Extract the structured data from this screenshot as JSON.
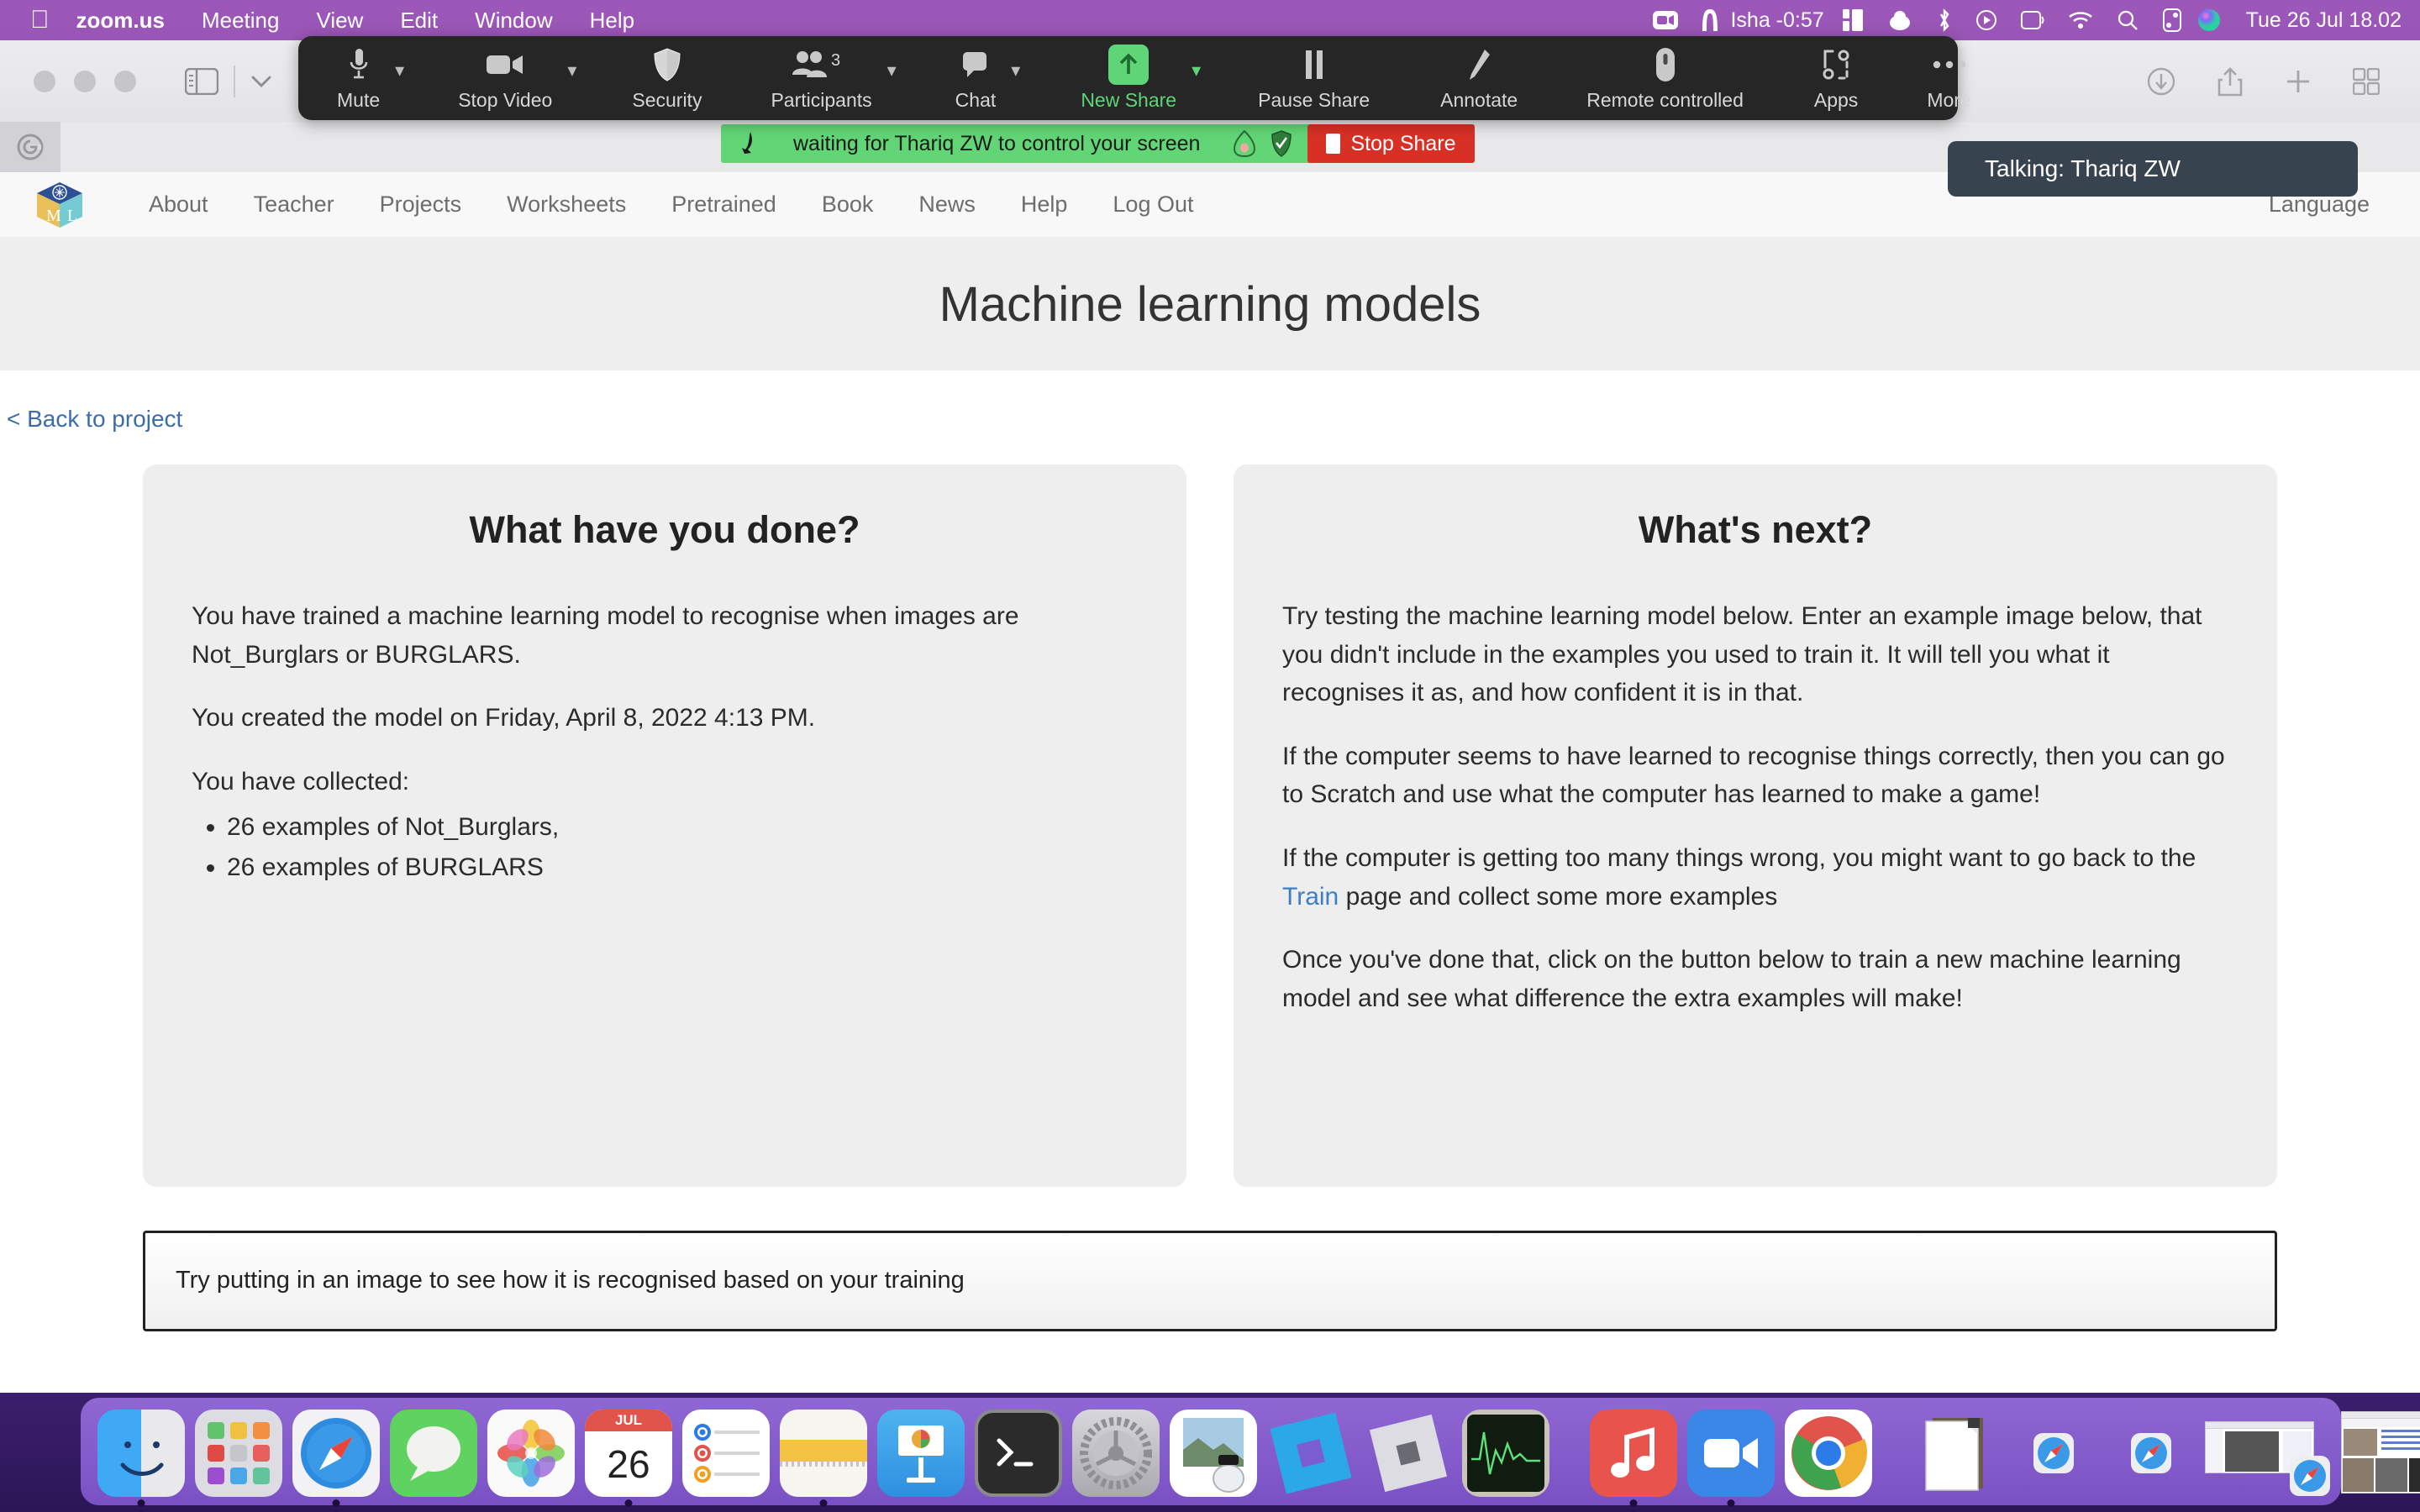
{
  "menubar": {
    "apple_icon": "apple-logo-icon",
    "items": [
      {
        "label": "zoom.us",
        "bold": true
      },
      {
        "label": "Meeting",
        "bold": false
      },
      {
        "label": "View",
        "bold": false
      },
      {
        "label": "Edit",
        "bold": false
      },
      {
        "label": "Window",
        "bold": false
      },
      {
        "label": "Help",
        "bold": false
      }
    ],
    "status": {
      "zoom_icon": "zoom-video-icon",
      "focus_icon": "focus-arch-icon",
      "timer_label": "Isha -0:57",
      "icons": [
        "stage-manager-icon",
        "cloud-icon",
        "bluetooth-icon",
        "now-playing-icon",
        "screen-mirroring-icon",
        "wifi-icon",
        "search-icon",
        "control-center-icon",
        "siri-icon"
      ],
      "clock": "Tue 26 Jul  18.02"
    },
    "bg_color": "#9a56b6"
  },
  "safari": {
    "toolbar": {
      "sidebar_icon": "sidebar-toggle-icon",
      "sidebar_menu_icon": "chevron-down-icon",
      "back_icon": "back-chevron-icon",
      "downloads_icon": "downloads-icon",
      "share_icon": "share-icon",
      "newtab_icon": "plus-icon",
      "tab_overview_icon": "tab-overview-icon"
    },
    "favicon_tab": {
      "icon": "google-favicon"
    }
  },
  "zoom_toolbar": {
    "buttons": [
      {
        "label": "Mute",
        "icon": "microphone-icon",
        "caret": true,
        "green": false
      },
      {
        "label": "Stop Video",
        "icon": "camera-icon",
        "caret": true,
        "green": false
      },
      {
        "label": "Security",
        "icon": "shield-icon",
        "caret": false,
        "green": false
      },
      {
        "label": "Participants",
        "icon": "participants-icon",
        "caret": true,
        "green": false,
        "badge": "3"
      },
      {
        "label": "Chat",
        "icon": "chat-bubble-icon",
        "caret": true,
        "green": false
      },
      {
        "label": "New Share",
        "icon": "share-screen-up-arrow-icon",
        "caret": true,
        "green": true
      },
      {
        "label": "Pause Share",
        "icon": "pause-icon",
        "caret": false,
        "green": false
      },
      {
        "label": "Annotate",
        "icon": "pencil-icon",
        "caret": false,
        "green": false
      },
      {
        "label": "Remote controlled",
        "icon": "mouse-icon",
        "caret": false,
        "green": false
      },
      {
        "label": "Apps",
        "icon": "apps-bracket-icon",
        "caret": false,
        "green": false
      },
      {
        "label": "More",
        "icon": "ellipsis-icon",
        "caret": false,
        "green": false
      }
    ],
    "accent_green": "#5fd578",
    "bg_color": "#262626"
  },
  "share_bar": {
    "cursor_icon": "remote-cursor-icon",
    "message": "waiting for Thariq ZW to control your screen",
    "icons": [
      "avocado-icon",
      "shield-check-icon"
    ],
    "stop_share_label": "Stop Share",
    "bg_color": "#62d576",
    "stop_color": "#d93025"
  },
  "talking_tooltip": {
    "text": "Talking: Thariq ZW",
    "bg_color": "#374450"
  },
  "site": {
    "logo_icon": "ml-for-kids-cube-logo",
    "nav_items": [
      "About",
      "Teacher",
      "Projects",
      "Worksheets",
      "Pretrained",
      "Book",
      "News",
      "Help",
      "Log Out"
    ],
    "language_label": "Language",
    "page_title": "Machine learning models",
    "back_link": "< Back to project",
    "cards": [
      {
        "heading": "What have you done?",
        "paragraphs": [
          "You have trained a machine learning model to recognise when images are Not_Burglars or BURGLARS.",
          "You created the model on Friday, April 8, 2022 4:13 PM.",
          "You have collected:"
        ],
        "list": [
          "26 examples of Not_Burglars,",
          "26 examples of BURGLARS"
        ]
      },
      {
        "heading": "What's next?",
        "paragraphs": [
          "Try testing the machine learning model below. Enter an example image below, that you didn't include in the examples you used to train it. It will tell you what it recognises it as, and how confident it is in that.",
          "If the computer seems to have learned to recognise things correctly, then you can go to Scratch and use what the computer has learned to make a game!"
        ],
        "paragraph_with_link": {
          "before": "If the computer is getting too many things wrong, you might want to go back to the ",
          "link": "Train",
          "after": " page and collect some more examples"
        },
        "last_paragraph": "Once you've done that, click on the button below to train a new machine learning model and see what difference the extra examples will make!"
      }
    ],
    "test_panel_text": "Try putting in an image to see how it is recognised based on your training"
  },
  "dock": {
    "items": [
      {
        "name": "finder",
        "running": true
      },
      {
        "name": "launchpad",
        "running": false
      },
      {
        "name": "safari",
        "running": true
      },
      {
        "name": "messages",
        "running": false
      },
      {
        "name": "photos",
        "running": false
      },
      {
        "name": "calendar",
        "running": true,
        "month": "JUL",
        "day": "26"
      },
      {
        "name": "reminders",
        "running": false
      },
      {
        "name": "notes",
        "running": true
      },
      {
        "name": "keynote",
        "running": false
      },
      {
        "name": "terminal",
        "running": false
      },
      {
        "name": "system-preferences",
        "running": false
      },
      {
        "name": "image-capture",
        "running": false
      },
      {
        "name": "roblox-studio",
        "running": false
      },
      {
        "name": "roblox",
        "running": false
      },
      {
        "name": "activity-monitor",
        "running": false
      },
      {
        "name": "separator-1",
        "separator": true
      },
      {
        "name": "music",
        "running": true
      },
      {
        "name": "zoom",
        "running": true
      },
      {
        "name": "chrome",
        "running": false
      },
      {
        "name": "separator-2",
        "separator": true
      },
      {
        "name": "document-stack",
        "running": false
      },
      {
        "name": "safari-window-1",
        "running": false
      },
      {
        "name": "safari-window-2",
        "running": false
      },
      {
        "name": "safari-window-3",
        "running": false
      },
      {
        "name": "safari-window-4",
        "running": false
      },
      {
        "name": "trash",
        "running": false
      }
    ],
    "bg_color": "#8056cd"
  }
}
